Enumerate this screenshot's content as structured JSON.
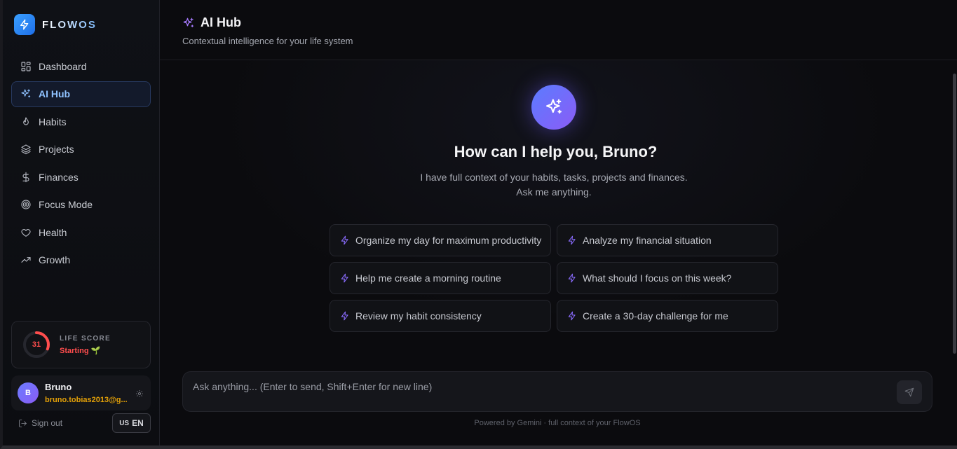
{
  "brand": {
    "name": "FLOWOS"
  },
  "sidebar": {
    "items": [
      {
        "label": "Dashboard",
        "icon": "grid-icon"
      },
      {
        "label": "AI Hub",
        "icon": "sparkles-icon",
        "active": true
      },
      {
        "label": "Habits",
        "icon": "flame-icon"
      },
      {
        "label": "Projects",
        "icon": "layers-icon"
      },
      {
        "label": "Finances",
        "icon": "dollar-icon"
      },
      {
        "label": "Focus Mode",
        "icon": "target-icon"
      },
      {
        "label": "Health",
        "icon": "heart-icon"
      },
      {
        "label": "Growth",
        "icon": "trending-up-icon"
      }
    ],
    "life_score": {
      "label": "LIFE SCORE",
      "value": "31",
      "progress": 0.31,
      "status": "Starting 🌱",
      "color": "#ff4d4d"
    },
    "user": {
      "initial": "B",
      "name": "Bruno",
      "email": "bruno.tobias2013@g..."
    },
    "signout_label": "Sign out",
    "lang": {
      "flag": "US",
      "code": "EN"
    }
  },
  "header": {
    "title": "AI Hub",
    "subtitle": "Contextual intelligence for your life system"
  },
  "hero": {
    "title": "How can I help you, Bruno?",
    "description": "I have full context of your habits, tasks, projects and finances. Ask me anything."
  },
  "suggestions": [
    "Organize my day for maximum productivity",
    "Analyze my financial situation",
    "Help me create a morning routine",
    "What should I focus on this week?",
    "Review my habit consistency",
    "Create a 30-day challenge for me"
  ],
  "composer": {
    "placeholder": "Ask anything... (Enter to send, Shift+Enter for new line)",
    "footer": "Powered by Gemini · full context of your FlowOS"
  },
  "colors": {
    "accent": "#8fc2ff",
    "purple": "#8b5cf6",
    "warning": "#e3a008"
  }
}
